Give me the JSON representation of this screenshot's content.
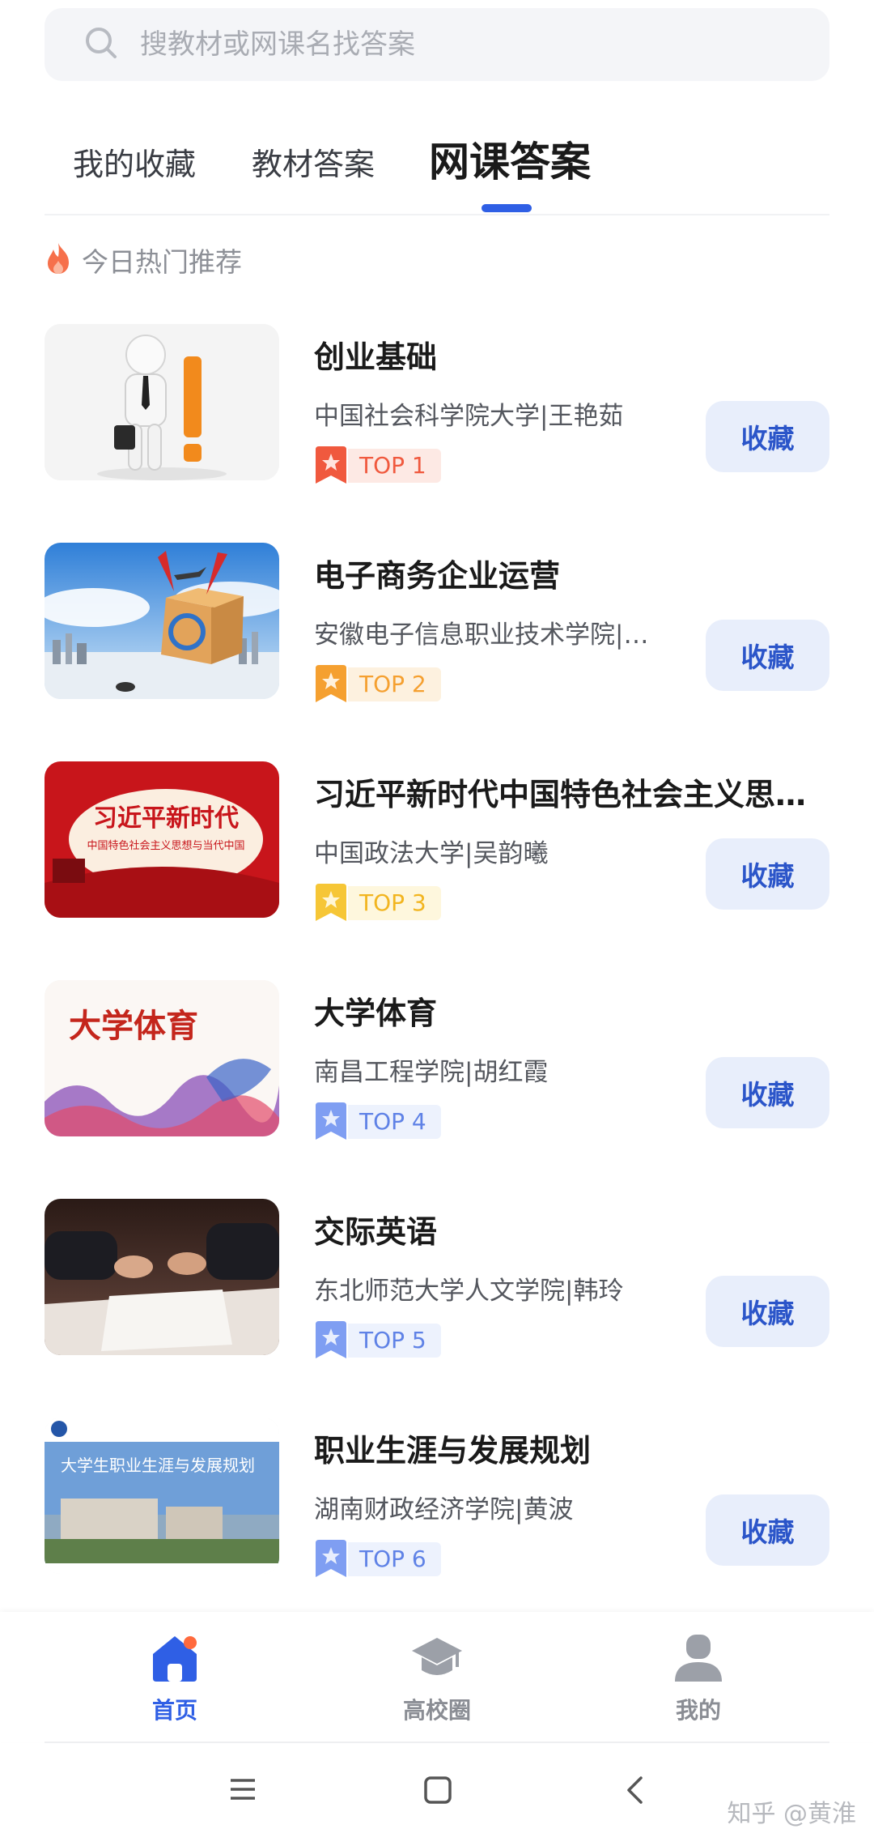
{
  "search": {
    "placeholder": "搜教材或网课名找答案"
  },
  "tabs": [
    {
      "label": "我的收藏"
    },
    {
      "label": "教材答案"
    },
    {
      "label": "网课答案"
    }
  ],
  "section": {
    "title": "今日热门推荐"
  },
  "courses": [
    {
      "title": "创业基础",
      "subtitle": "中国社会科学院大学|王艳茹",
      "rank": "TOP 1",
      "action": "收藏",
      "badge_color": "#f0593e",
      "badge_bg": "#fde9e4"
    },
    {
      "title": "电子商务企业运营",
      "subtitle": "安徽电子信息职业技术学院|…",
      "rank": "TOP 2",
      "action": "收藏",
      "badge_color": "#f5a030",
      "badge_bg": "#fdf1df"
    },
    {
      "title": "习近平新时代中国特色社会主义思…",
      "subtitle": "中国政法大学|吴韵曦",
      "rank": "TOP 3",
      "action": "收藏",
      "badge_color": "#f6c636",
      "badge_bg": "#fef7dd"
    },
    {
      "title": "大学体育",
      "subtitle": "南昌工程学院|胡红霞",
      "rank": "TOP 4",
      "action": "收藏",
      "badge_color": "#7f9ef2",
      "badge_bg": "#edf2fd"
    },
    {
      "title": "交际英语",
      "subtitle": "东北师范大学人文学院|韩玲",
      "rank": "TOP 5",
      "action": "收藏",
      "badge_color": "#7f9ef2",
      "badge_bg": "#edf2fd"
    },
    {
      "title": "职业生涯与发展规划",
      "subtitle": "湖南财政经济学院|黄波",
      "rank": "TOP 6",
      "action": "收藏",
      "badge_color": "#7f9ef2",
      "badge_bg": "#edf2fd"
    }
  ],
  "thumbnails": {
    "c2_text": "",
    "c3_text": "习近平新时代",
    "c3_sub": "中国特色社会主义思想与当代中国",
    "c4_text": "大学体育",
    "c6_text": "大学生职业生涯与发展规划"
  },
  "bottom_nav": [
    {
      "label": "首页",
      "icon": "home-icon",
      "active": true
    },
    {
      "label": "高校圈",
      "icon": "graduation-cap-icon",
      "active": false
    },
    {
      "label": "我的",
      "icon": "user-icon",
      "active": false
    }
  ],
  "watermark": "知乎 @黄淮",
  "colors": {
    "accent": "#2f5fe5",
    "button_bg": "#e8eefb",
    "button_text": "#2b55c9"
  }
}
